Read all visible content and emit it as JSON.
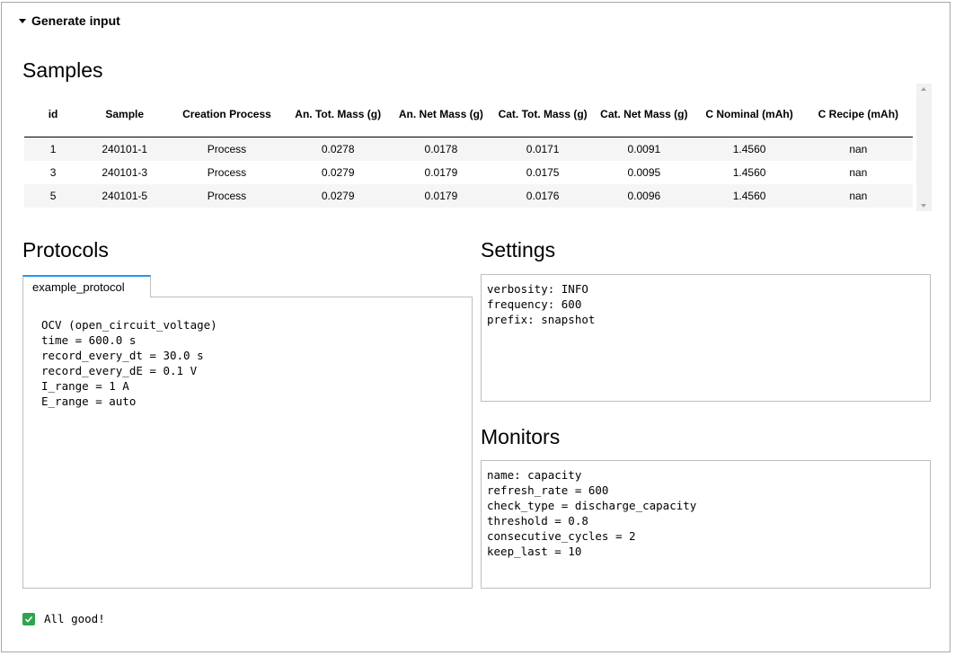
{
  "header": {
    "title": "Generate input"
  },
  "samples": {
    "title": "Samples",
    "columns": [
      "id",
      "Sample",
      "Creation Process",
      "An. Tot. Mass (g)",
      "An. Net Mass (g)",
      "Cat. Tot. Mass (g)",
      "Cat. Net Mass (g)",
      "C Nominal (mAh)",
      "C Recipe (mAh)"
    ],
    "rows": [
      [
        "1",
        "240101-1",
        "Process",
        "0.0278",
        "0.0178",
        "0.0171",
        "0.0091",
        "1.4560",
        "nan"
      ],
      [
        "3",
        "240101-3",
        "Process",
        "0.0279",
        "0.0179",
        "0.0175",
        "0.0095",
        "1.4560",
        "nan"
      ],
      [
        "5",
        "240101-5",
        "Process",
        "0.0279",
        "0.0179",
        "0.0176",
        "0.0096",
        "1.4560",
        "nan"
      ]
    ]
  },
  "protocols": {
    "title": "Protocols",
    "tab_label": "example_protocol",
    "content": "OCV (open_circuit_voltage)\ntime = 600.0 s\nrecord_every_dt = 30.0 s\nrecord_every_dE = 0.1 V\nI_range = 1 A\nE_range = auto"
  },
  "settings": {
    "title": "Settings",
    "content": "verbosity: INFO\nfrequency: 600\nprefix: snapshot"
  },
  "monitors": {
    "title": "Monitors",
    "content": "name: capacity\nrefresh_rate = 600\ncheck_type = discharge_capacity\nthreshold = 0.8\nconsecutive_cycles = 2\nkeep_last = 10"
  },
  "status": {
    "text": "All good!",
    "color": "#2ea44f"
  }
}
